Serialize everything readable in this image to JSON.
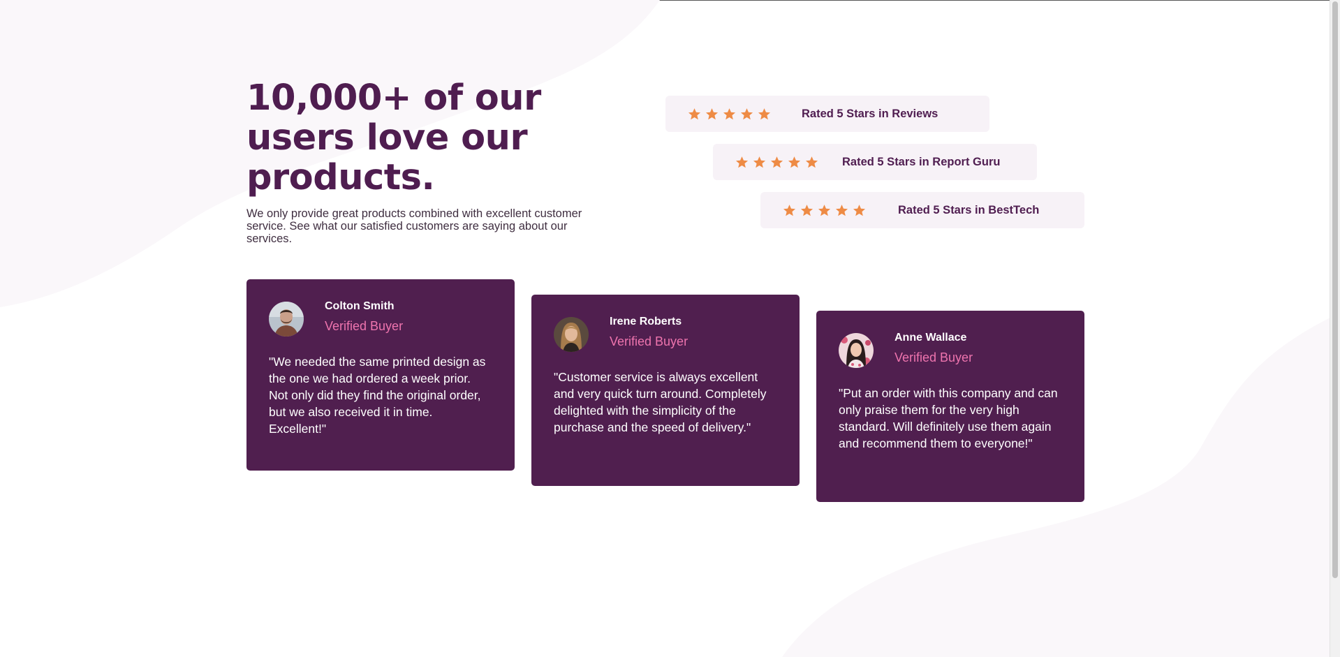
{
  "hero": {
    "title": "10,000+ of our users love our products.",
    "description": "We only provide great products combined with excellent customer service. See what our satisfied customers are saying about our services."
  },
  "ratings": [
    {
      "stars": 5,
      "label": "Rated 5 Stars in Reviews"
    },
    {
      "stars": 5,
      "label": "Rated 5 Stars in Report Guru"
    },
    {
      "stars": 5,
      "label": "Rated 5 Stars in BestTech"
    }
  ],
  "testimonials": [
    {
      "name": "Colton Smith",
      "badge": "Verified Buyer",
      "quote": "\"We needed the same printed design as the one we had ordered a week prior. Not only did they find the original order, but we also received it in time. Excellent!\"",
      "avatar_icon": "avatar-man-icon"
    },
    {
      "name": "Irene Roberts",
      "badge": "Verified Buyer",
      "quote": "\"Customer service is always excellent and very quick turn around. Completely delighted with the simplicity of the purchase and the speed of delivery.\"",
      "avatar_icon": "avatar-woman-icon"
    },
    {
      "name": "Anne Wallace",
      "badge": "Verified Buyer",
      "quote": "\"Put an order with this company and can only praise them for the very high standard. Will definitely use them again and recommend them to everyone!\"",
      "avatar_icon": "avatar-woman-icon"
    }
  ],
  "icons": {
    "star": "star-icon"
  },
  "colors": {
    "primary": "#4f1d50",
    "card_bg": "#501f4f",
    "accent_pink": "#ee74ae",
    "star": "#ee8b45",
    "rating_bg": "#f7f2f7",
    "page_bg": "#ffffff"
  }
}
